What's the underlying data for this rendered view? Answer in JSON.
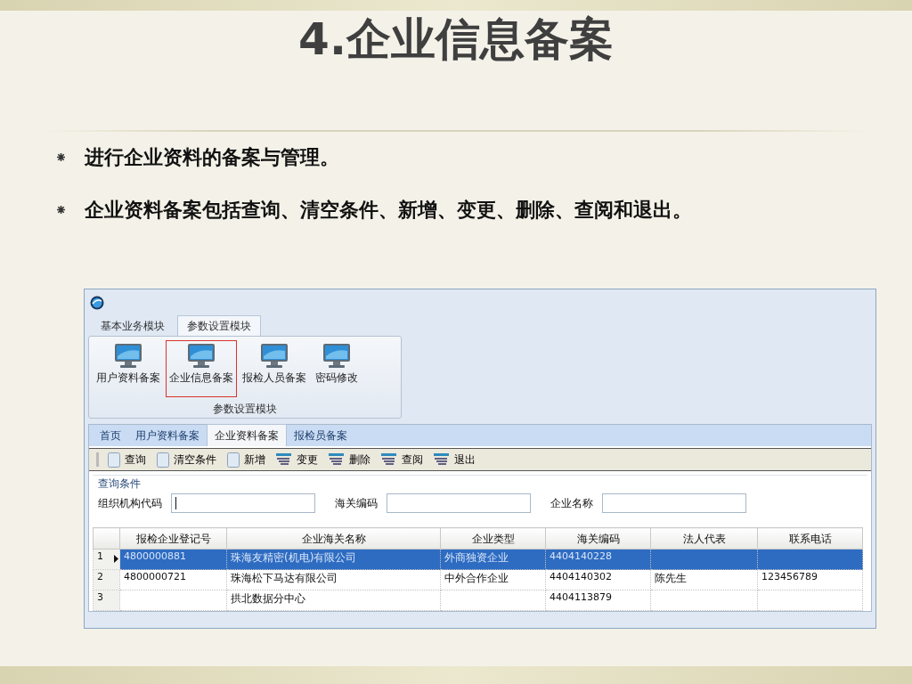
{
  "slide": {
    "title": "4.企业信息备案",
    "bullets": [
      "进行企业资料的备案与管理。",
      "企业资料备案包括查询、清空条件、新增、变更、删除、查阅和退出。"
    ]
  },
  "app": {
    "module_tabs": [
      {
        "label": "基本业务模块",
        "selected": false
      },
      {
        "label": "参数设置模块",
        "selected": true
      }
    ],
    "ribbon": {
      "buttons": [
        {
          "label": "用户资料备案",
          "selected": false
        },
        {
          "label": "企业信息备案",
          "selected": true
        },
        {
          "label": "报检人员备案",
          "selected": false
        },
        {
          "label": "密码修改",
          "selected": false
        }
      ],
      "group_label": "参数设置模块"
    },
    "page_tabs": [
      {
        "label": "首页",
        "selected": false
      },
      {
        "label": "用户资料备案",
        "selected": false
      },
      {
        "label": "企业资料备案",
        "selected": true
      },
      {
        "label": "报检员备案",
        "selected": false
      }
    ],
    "toolbar": [
      {
        "label": "查询",
        "kind": "page"
      },
      {
        "label": "清空条件",
        "kind": "page"
      },
      {
        "label": "新增",
        "kind": "page"
      },
      {
        "label": "变更",
        "kind": "list"
      },
      {
        "label": "删除",
        "kind": "list"
      },
      {
        "label": "查阅",
        "kind": "list"
      },
      {
        "label": "退出",
        "kind": "list"
      }
    ],
    "query": {
      "legend": "查询条件",
      "fields": [
        {
          "label": "组织机构代码",
          "focused": true
        },
        {
          "label": "海关编码",
          "focused": false
        },
        {
          "label": "企业名称",
          "focused": false
        }
      ]
    },
    "table": {
      "columns": [
        "报检企业登记号",
        "企业海关名称",
        "企业类型",
        "海关编码",
        "法人代表",
        "联系电话"
      ],
      "rows": [
        {
          "number": "1",
          "selected": true,
          "cells": [
            "4800000881",
            "珠海友精密(机电)有限公司",
            "外商独资企业",
            "4404140228",
            "",
            ""
          ]
        },
        {
          "number": "2",
          "selected": false,
          "cells": [
            "4800000721",
            "珠海松下马达有限公司",
            "中外合作企业",
            "4404140302",
            "陈先生",
            "123456789"
          ]
        },
        {
          "number": "3",
          "selected": false,
          "cells": [
            "",
            "拱北数据分中心",
            "",
            "4404113879",
            "",
            ""
          ]
        }
      ]
    }
  }
}
